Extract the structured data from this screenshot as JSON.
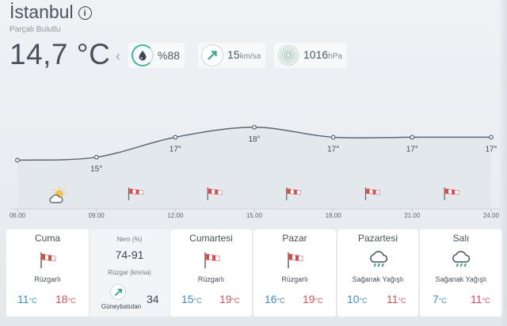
{
  "header": {
    "city": "İstanbul",
    "condition": "Parçalı Bulutlu",
    "temperature": "14,7 °C"
  },
  "stats": {
    "humidity": {
      "value": "%88",
      "icon": "water-drop-icon",
      "ring_color": "#3fb6a0"
    },
    "wind": {
      "value": "15",
      "unit": "km/sa",
      "icon": "wind-arrow-icon",
      "arrow_color": "#35a97f"
    },
    "pressure": {
      "value": "1016",
      "unit": "hPa",
      "icon": "pressure-ripple-icon"
    }
  },
  "hourly": {
    "times": [
      "06.00",
      "09.00",
      "12.00",
      "15.00",
      "18.00",
      "21.00",
      "24.00"
    ],
    "temps": [
      "",
      "15°",
      "17°",
      "18°",
      "17°",
      "17°",
      "17°"
    ],
    "icons": [
      "partly-cloudy-icon",
      "wind-flag-icon",
      "wind-flag-icon",
      "wind-flag-icon",
      "wind-flag-icon",
      "wind-flag-icon"
    ]
  },
  "chart_data": {
    "type": "line",
    "x": [
      "06.00",
      "09.00",
      "12.00",
      "15.00",
      "18.00",
      "21.00",
      "24.00"
    ],
    "y": [
      14.7,
      15,
      17,
      18,
      17,
      17,
      17
    ],
    "data_labels": [
      "",
      "15°",
      "17°",
      "18°",
      "17°",
      "17°",
      "17°"
    ],
    "line_color": "#5d6872",
    "fill_color": "#dde3e8"
  },
  "days": [
    {
      "name": "Cuma",
      "desc": "Rüzgarlı",
      "icon": "wind-flag-icon",
      "lo": "11",
      "hi": "18"
    },
    {
      "name": "Cumartesi",
      "desc": "Rüzgarlı",
      "icon": "wind-flag-icon",
      "lo": "15",
      "hi": "19"
    },
    {
      "name": "Pazar",
      "desc": "Rüzgarlı",
      "icon": "wind-flag-icon",
      "lo": "16",
      "hi": "19"
    },
    {
      "name": "Pazartesi",
      "desc": "Sağanak Yağışlı",
      "icon": "rain-shower-icon",
      "lo": "10",
      "hi": "11"
    },
    {
      "name": "Salı",
      "desc": "Sağanak Yağışlı",
      "icon": "rain-shower-icon",
      "lo": "7",
      "hi": "11"
    }
  ],
  "day_detail": {
    "humidity_label": "Nem (%)",
    "humidity_value": "74-91",
    "wind_label": "Rüzgar (km/sa)",
    "wind_dir": "Güneybatıdan",
    "wind_value": "34"
  },
  "units": {
    "celsius": "°C"
  },
  "colors": {
    "low_temp": "#3a8fcb",
    "high_temp": "#d6505a",
    "flag_red": "#d94a4a"
  }
}
